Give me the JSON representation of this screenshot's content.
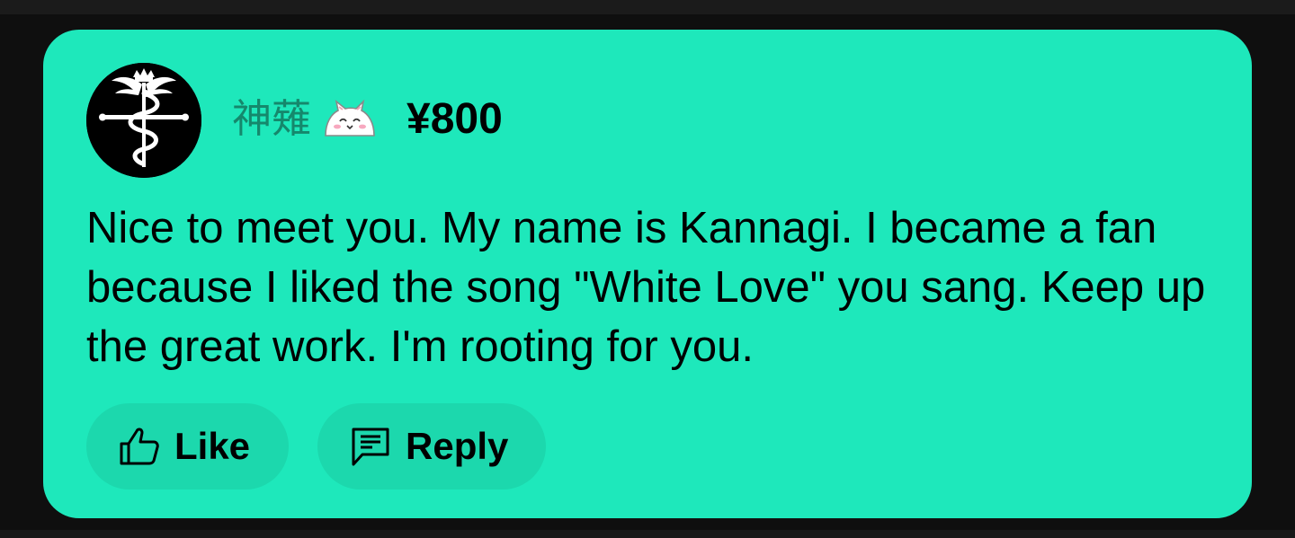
{
  "comment": {
    "username": "神薙",
    "badge_icon": "cat-emoji-icon",
    "amount": "¥800",
    "message": "Nice to meet you. My name is Kannagi. I became a fan because I liked the song \"White Love\" you sang. Keep up the great work. I'm rooting for you.",
    "avatar_icon": "flamel-cross-icon"
  },
  "actions": {
    "like_label": "Like",
    "like_icon": "thumbs-up-icon",
    "reply_label": "Reply",
    "reply_icon": "comment-icon"
  },
  "colors": {
    "card_background": "#1ee8bb",
    "button_background": "#1cd8ad",
    "username_color": "#15886c",
    "page_background": "#0f0f0f"
  }
}
